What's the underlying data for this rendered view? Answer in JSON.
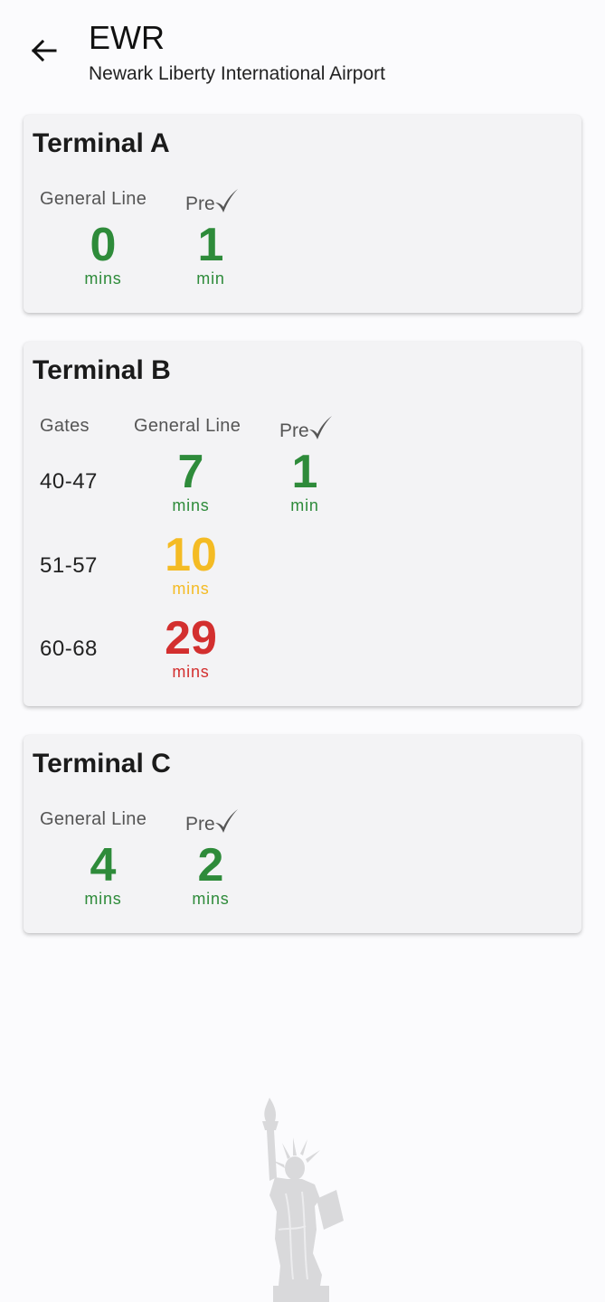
{
  "header": {
    "code": "EWR",
    "name": "Newark Liberty International Airport"
  },
  "colors": {
    "green": "#2e8b3a",
    "yellow": "#f4bb24",
    "red": "#d32f2f"
  },
  "terminal_a": {
    "title": "Terminal A",
    "general_label": "General Line",
    "pre_label": "Pre",
    "general_value": "0",
    "general_unit": "mins",
    "pre_value": "1",
    "pre_unit": "min"
  },
  "terminal_b": {
    "title": "Terminal B",
    "gates_label": "Gates",
    "general_label": "General Line",
    "pre_label": "Pre",
    "rows": [
      {
        "gates": "40-47",
        "general_value": "7",
        "general_unit": "mins",
        "pre_value": "1",
        "pre_unit": "min"
      },
      {
        "gates": "51-57",
        "general_value": "10",
        "general_unit": "mins"
      },
      {
        "gates": "60-68",
        "general_value": "29",
        "general_unit": "mins"
      }
    ]
  },
  "terminal_c": {
    "title": "Terminal C",
    "general_label": "General Line",
    "pre_label": "Pre",
    "general_value": "4",
    "general_unit": "mins",
    "pre_value": "2",
    "pre_unit": "mins"
  },
  "icons": {
    "back": "arrow-left-icon",
    "precheck": "checkmark-icon",
    "illustration": "statue-of-liberty"
  }
}
